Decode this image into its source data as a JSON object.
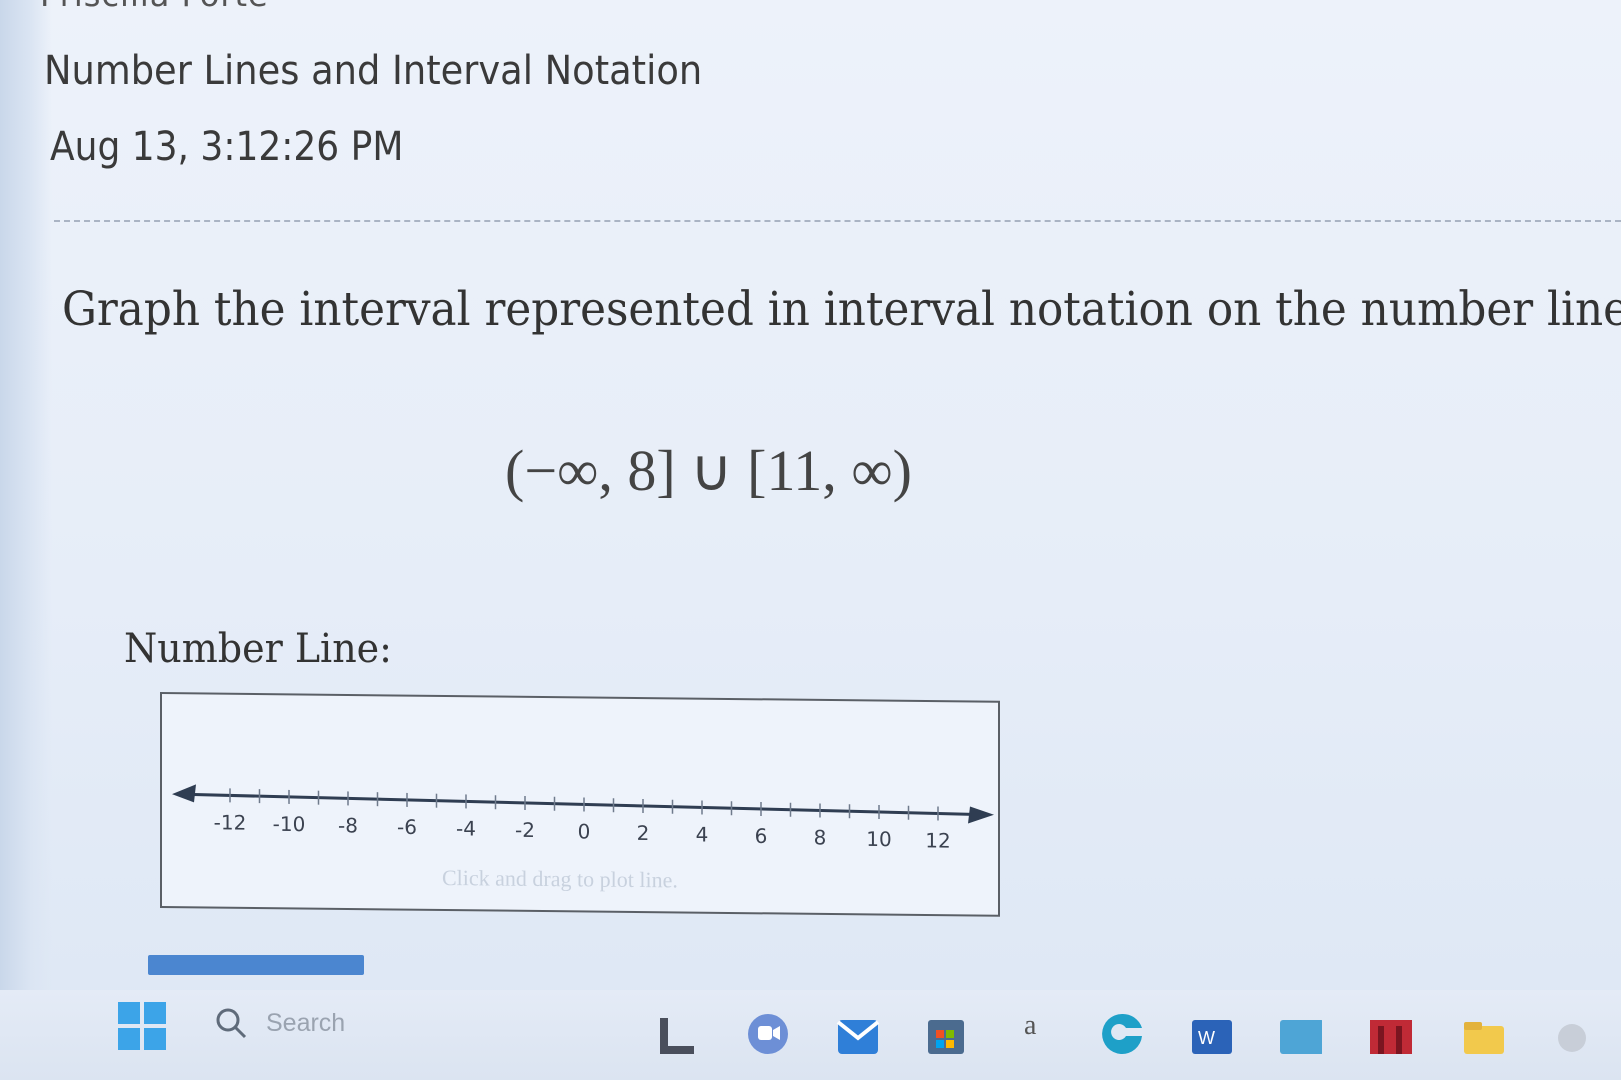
{
  "header": {
    "cut_name": "Priscilla Forte",
    "assignment_title": "Number Lines and Interval Notation",
    "timestamp": "Aug 13, 3:12:26 PM"
  },
  "problem": {
    "prompt": "Graph the interval represented in interval notation on the number line.",
    "expression": "(−∞, 8] ∪ [11, ∞)"
  },
  "number_line": {
    "label": "Number Line:",
    "tick_labels": [
      "-12",
      "-10",
      "-8",
      "-6",
      "-4",
      "-2",
      "0",
      "2",
      "4",
      "6",
      "8",
      "10",
      "12"
    ],
    "hint": "Click and drag to plot line."
  },
  "taskbar": {
    "search_placeholder": "Search",
    "app_letter": "a"
  },
  "colors": {
    "accent_blue": "#4b86d0",
    "windows_blue": "#3ca4e8",
    "axis": "#2f3d52"
  }
}
